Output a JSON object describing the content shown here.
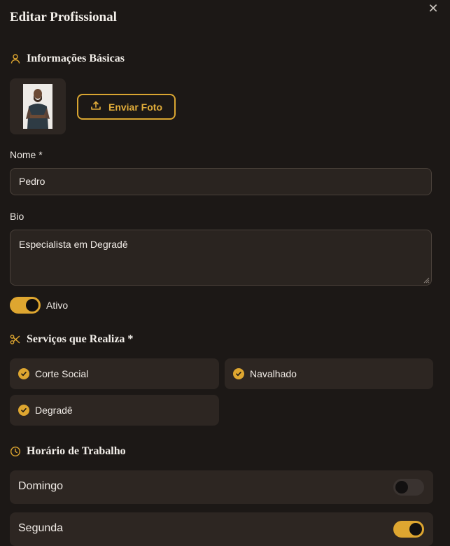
{
  "dialog": {
    "title": "Editar Profissional",
    "close_icon": "close-icon"
  },
  "basic_info": {
    "heading": "Informações Básicas",
    "heading_icon": "user-icon",
    "upload_label": "Enviar Foto",
    "upload_icon": "upload-icon",
    "name_label": "Nome *",
    "name_value": "Pedro",
    "bio_label": "Bio",
    "bio_value": "Especialista em Degradê",
    "active_label": "Ativo",
    "active": true
  },
  "services": {
    "heading": "Serviços que Realiza *",
    "heading_icon": "scissors-icon",
    "items": [
      {
        "label": "Corte Social",
        "checked": true
      },
      {
        "label": "Navalhado",
        "checked": true
      },
      {
        "label": "Degradê",
        "checked": true
      }
    ]
  },
  "schedule": {
    "heading": "Horário de Trabalho",
    "heading_icon": "clock-icon",
    "days": [
      {
        "label": "Domingo",
        "enabled": false
      },
      {
        "label": "Segunda",
        "enabled": true
      }
    ]
  },
  "colors": {
    "accent": "#dea630",
    "background": "#1c1816",
    "card": "#2d2622"
  }
}
